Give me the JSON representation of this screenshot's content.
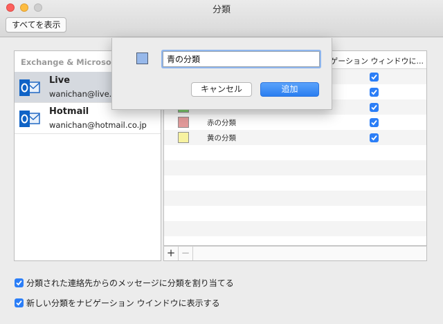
{
  "window": {
    "title": "分類"
  },
  "toolbar": {
    "show_all_label": "すべてを表示"
  },
  "accounts": {
    "header": "Exchange & Microsoft ア",
    "items": [
      {
        "name": "Live",
        "email": "wanichan@live.jp",
        "icon": "outlook-icon",
        "selected": true
      },
      {
        "name": "Hotmail",
        "email": "wanichan@hotmail.co.jp",
        "icon": "outlook-icon",
        "selected": false
      }
    ]
  },
  "categories": {
    "column_nav_header": "ビゲーション ウィンドウに...",
    "rows": [
      {
        "label": "",
        "color": "",
        "show_in_nav": true
      },
      {
        "label": "",
        "color": "",
        "show_in_nav": true
      },
      {
        "label": "",
        "color": "#7fcf6f",
        "show_in_nav": true
      },
      {
        "label": "赤の分類",
        "color": "#e39b9b",
        "show_in_nav": true
      },
      {
        "label": "黄の分類",
        "color": "#f7f2a0",
        "show_in_nav": true
      }
    ],
    "add_label": "+",
    "remove_label": "−"
  },
  "options": {
    "assign_from_contacts": {
      "label": "分類された連絡先からのメッセージに分類を割り当てる",
      "checked": true
    },
    "show_new_in_nav": {
      "label": "新しい分類をナビゲーション ウインドウに表示する",
      "checked": true
    }
  },
  "dialog": {
    "swatch_color": "#97b8ea",
    "name_value": "青の分類",
    "cancel_label": "キャンセル",
    "ok_label": "追加"
  }
}
